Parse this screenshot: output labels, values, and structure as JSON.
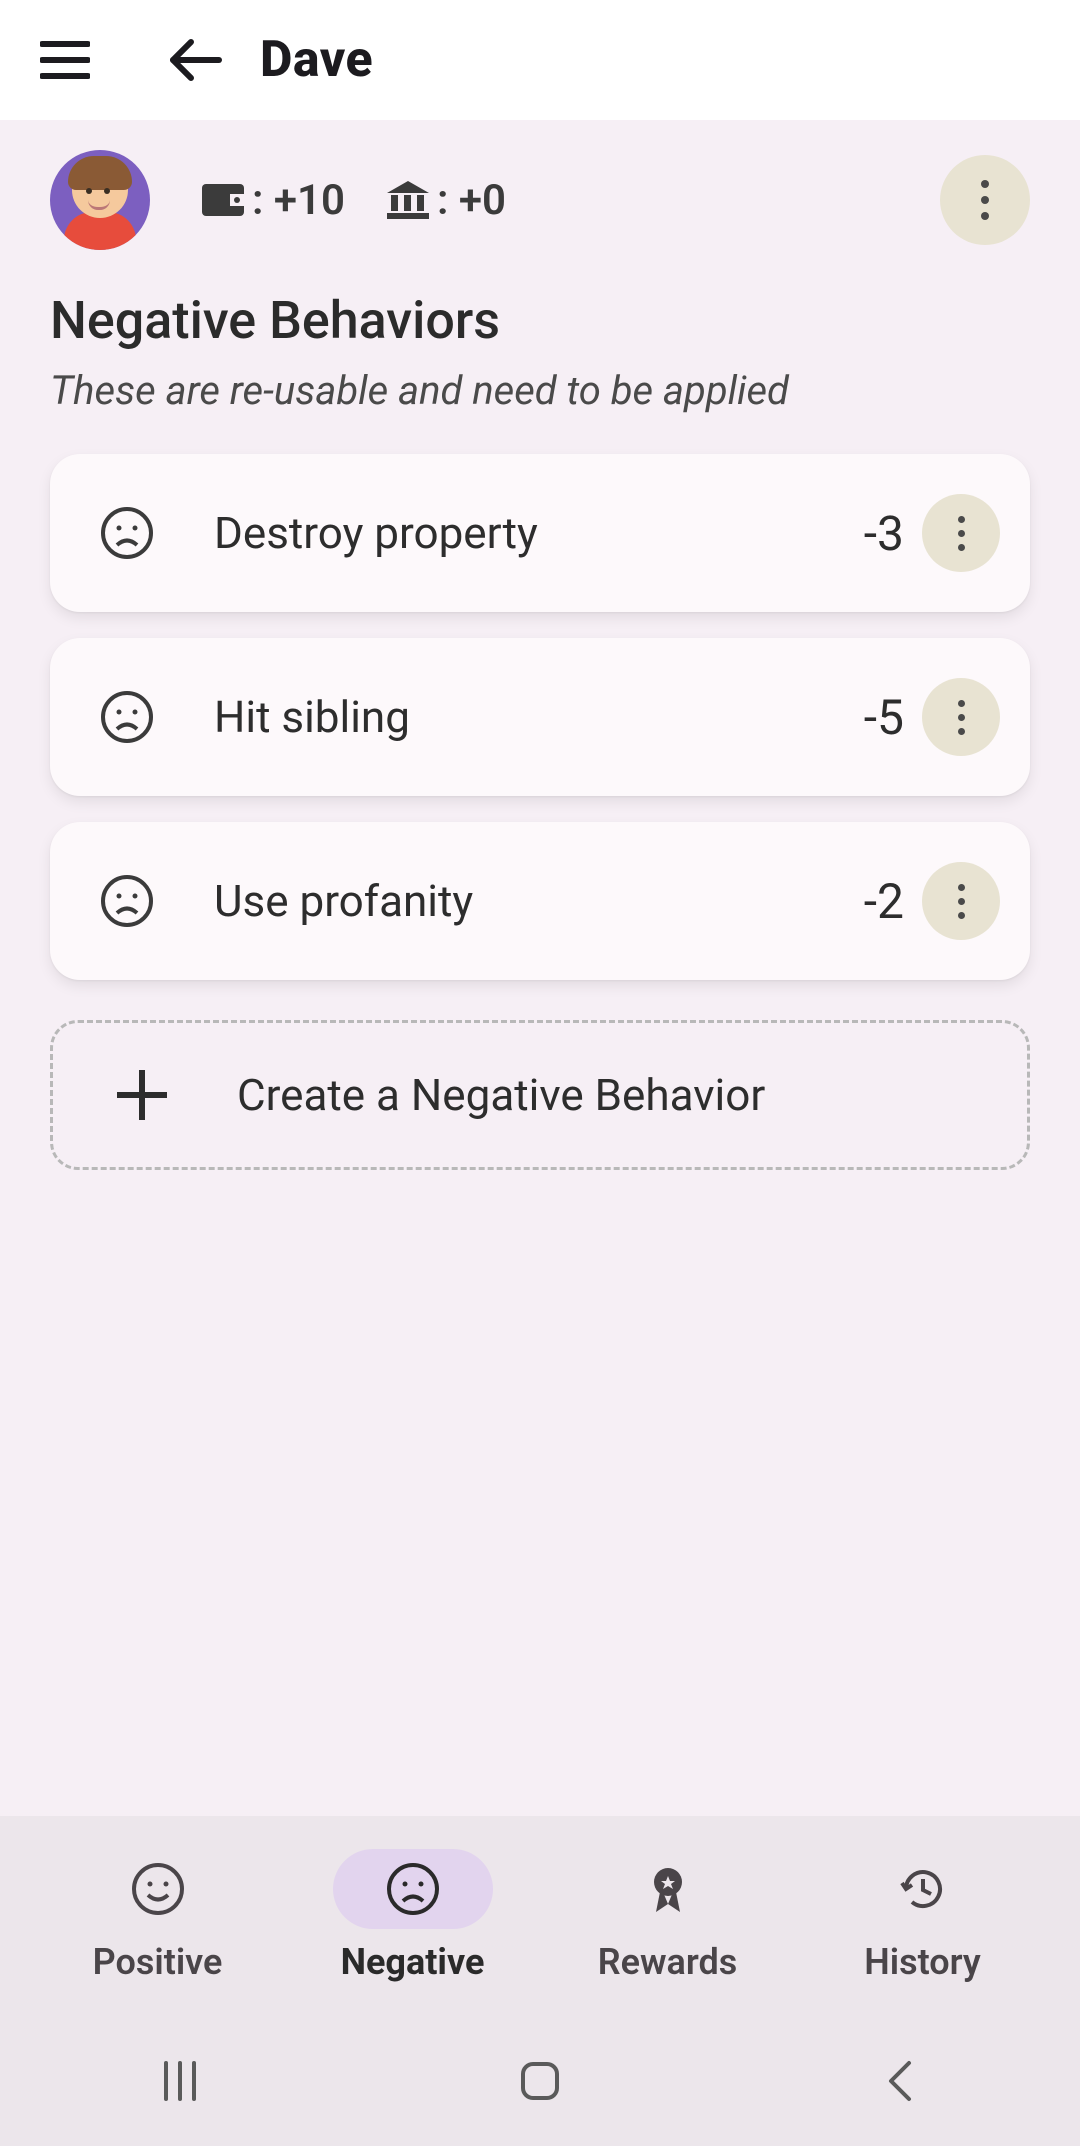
{
  "appbar": {
    "title": "Dave"
  },
  "overview": {
    "wallet_label": ": +10",
    "bank_label": ": +0"
  },
  "section": {
    "title": "Negative Behaviors",
    "subtitle": "These are re-usable and need to be applied"
  },
  "behaviors": [
    {
      "label": "Destroy property",
      "points": "-3"
    },
    {
      "label": "Hit sibling",
      "points": "-5"
    },
    {
      "label": "Use profanity",
      "points": "-2"
    }
  ],
  "create_label": "Create a Negative Behavior",
  "bottomnav": {
    "items": [
      {
        "label": "Positive",
        "icon": "smile",
        "active": false
      },
      {
        "label": "Negative",
        "icon": "frown",
        "active": true
      },
      {
        "label": "Rewards",
        "icon": "ribbon",
        "active": false
      },
      {
        "label": "History",
        "icon": "history",
        "active": false
      }
    ]
  }
}
